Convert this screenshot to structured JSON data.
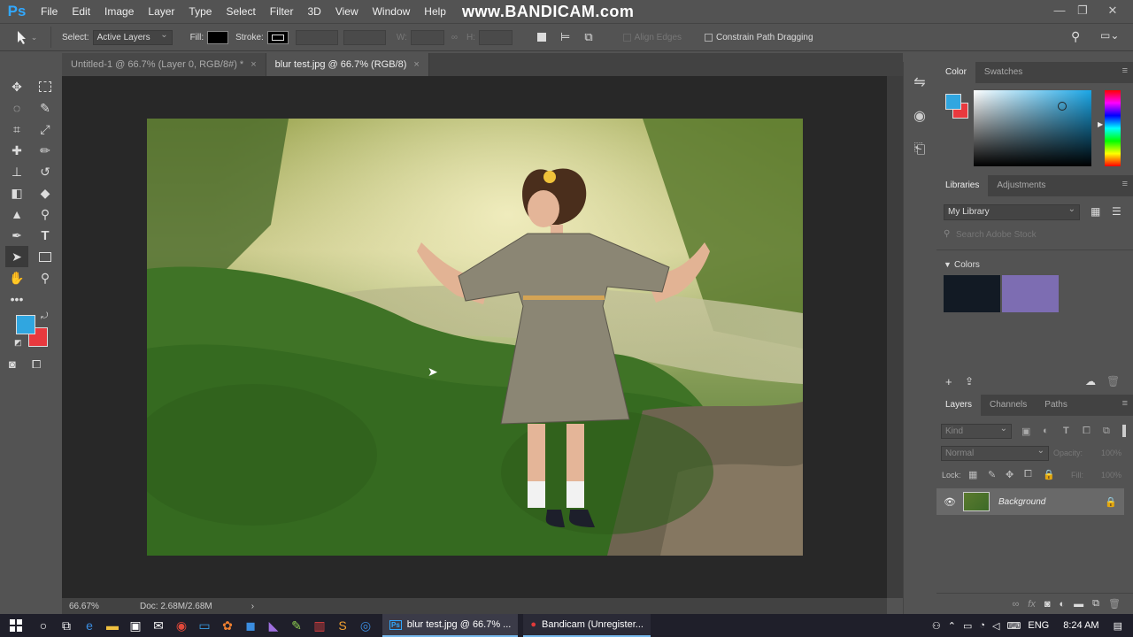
{
  "app": {
    "logo": "Ps",
    "watermark": "www.BANDICAM.com"
  },
  "menu": [
    "File",
    "Edit",
    "Image",
    "Layer",
    "Type",
    "Select",
    "Filter",
    "3D",
    "View",
    "Window",
    "Help"
  ],
  "window_controls": {
    "minimize": "—",
    "restore": "❐",
    "close": "✕"
  },
  "options": {
    "select_label": "Select:",
    "select_value": "Active Layers",
    "fill_label": "Fill:",
    "stroke_label": "Stroke:",
    "w_label": "W:",
    "h_label": "H:",
    "align_edges": "Align Edges",
    "constrain": "Constrain Path Dragging"
  },
  "tabs": [
    {
      "label": "Untitled-1 @ 66.7% (Layer 0, RGB/8#) *",
      "close": "×"
    },
    {
      "label": "blur test.jpg @ 66.7% (RGB/8)",
      "close": "×"
    }
  ],
  "status": {
    "zoom": "66.67%",
    "doc": "Doc: 2.68M/2.68M",
    "arrow": "›"
  },
  "colors": {
    "foreground": "#30a6e0",
    "background": "#e8393e"
  },
  "color_panel": {
    "tabs": [
      "Color",
      "Swatches"
    ]
  },
  "libraries": {
    "tabs": [
      "Libraries",
      "Adjustments"
    ],
    "library": "My Library",
    "search_placeholder": "Search Adobe Stock",
    "section": "Colors",
    "swatches": [
      "#121a24",
      "#7d6db2"
    ]
  },
  "layers": {
    "tabs": [
      "Layers",
      "Channels",
      "Paths"
    ],
    "kind": "Kind",
    "blend": "Normal",
    "opacity_label": "Opacity:",
    "opacity": "100%",
    "lock_label": "Lock:",
    "fill_label": "Fill:",
    "fill": "100%",
    "layer_name": "Background"
  },
  "taskbar": {
    "apps": [
      {
        "label": "blur test.jpg @ 66.7% ..."
      },
      {
        "label": "Bandicam (Unregister..."
      }
    ],
    "lang": "ENG",
    "time": "8:24 AM"
  }
}
